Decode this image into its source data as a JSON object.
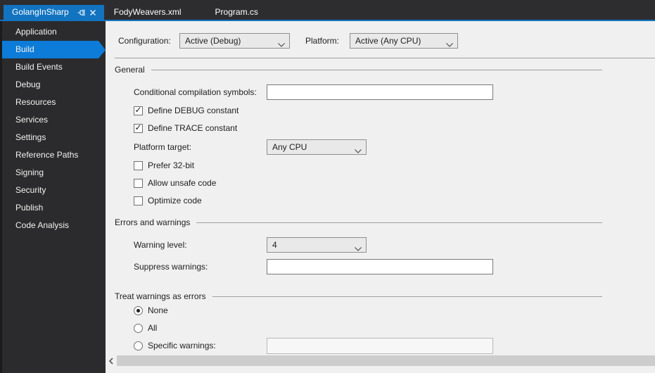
{
  "window": {
    "title": "Visual Studio project properties - Build page"
  },
  "colors": {
    "tab_active_bg": "#1273c0",
    "sidebar_selected_bg": "#0c7cd8",
    "strip_bg": "#2d2d30",
    "sidebar_bg": "#2b2b2d",
    "page_bg": "#f0f0f0",
    "section_rule": "#9f9f9f"
  },
  "tabs": [
    {
      "label": "GolangInSharp",
      "active": true,
      "icons": [
        "pin-icon",
        "close-icon"
      ]
    },
    {
      "label": "FodyWeavers.xml",
      "active": false
    },
    {
      "label": "Program.cs",
      "active": false
    }
  ],
  "sidebar": {
    "items": [
      {
        "label": "Application",
        "selected": false
      },
      {
        "label": "Build",
        "selected": true
      },
      {
        "label": "Build Events",
        "selected": false
      },
      {
        "label": "Debug",
        "selected": false
      },
      {
        "label": "Resources",
        "selected": false
      },
      {
        "label": "Services",
        "selected": false
      },
      {
        "label": "Settings",
        "selected": false
      },
      {
        "label": "Reference Paths",
        "selected": false
      },
      {
        "label": "Signing",
        "selected": false
      },
      {
        "label": "Security",
        "selected": false
      },
      {
        "label": "Publish",
        "selected": false
      },
      {
        "label": "Code Analysis",
        "selected": false
      }
    ]
  },
  "build_page": {
    "configuration": {
      "label": "Configuration:",
      "value": "Active (Debug)"
    },
    "platform": {
      "label": "Platform:",
      "value": "Active (Any CPU)"
    },
    "general": {
      "title": "General",
      "conditional_symbols": {
        "label": "Conditional compilation symbols:",
        "value": ""
      },
      "define_debug": {
        "label": "Define DEBUG constant",
        "checked": true
      },
      "define_trace": {
        "label": "Define TRACE constant",
        "checked": true
      },
      "platform_target": {
        "label": "Platform target:",
        "value": "Any CPU"
      },
      "prefer_32bit": {
        "label": "Prefer 32-bit",
        "checked": false
      },
      "allow_unsafe": {
        "label": "Allow unsafe code",
        "checked": false
      },
      "optimize_code": {
        "label": "Optimize code",
        "checked": false
      }
    },
    "errors_warnings": {
      "title": "Errors and warnings",
      "warning_level": {
        "label": "Warning level:",
        "value": "4"
      },
      "suppress_warnings": {
        "label": "Suppress warnings:",
        "value": ""
      }
    },
    "treat_warnings": {
      "title": "Treat warnings as errors",
      "options": [
        {
          "label": "None",
          "selected": true
        },
        {
          "label": "All",
          "selected": false
        },
        {
          "label": "Specific warnings:",
          "selected": false
        }
      ],
      "specific_value": ""
    }
  },
  "scrollbar": {
    "orientation": "horizontal",
    "left_arrow": "scroll-left-icon"
  }
}
